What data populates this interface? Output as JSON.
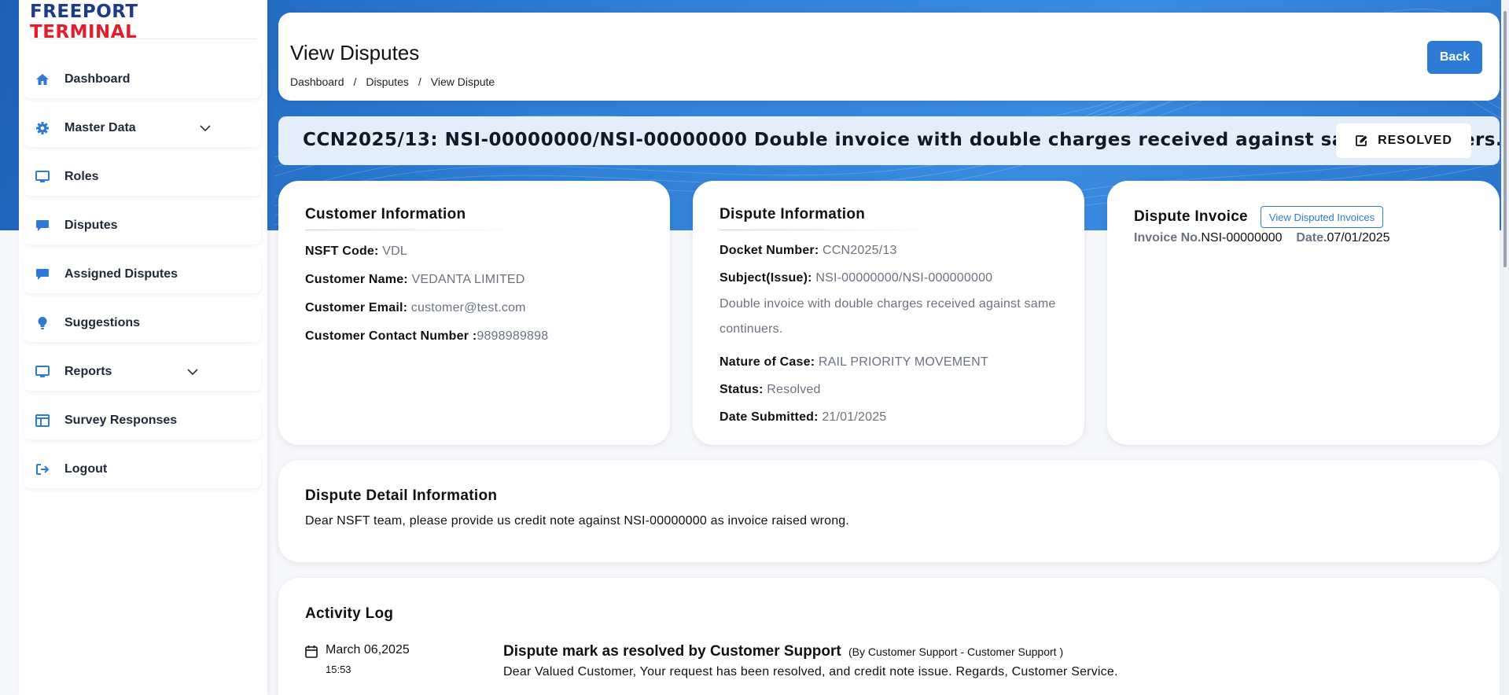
{
  "brand": {
    "part1": "FREEPORT",
    "part2": "TERMINAL"
  },
  "sidebar": {
    "items": [
      {
        "label": "Dashboard",
        "icon": "home-icon"
      },
      {
        "label": "Master Data",
        "icon": "gear-icon",
        "expandable": true
      },
      {
        "label": "Roles",
        "icon": "monitor-icon"
      },
      {
        "label": "Disputes",
        "icon": "chat-icon"
      },
      {
        "label": "Assigned Disputes",
        "icon": "chat-icon"
      },
      {
        "label": "Suggestions",
        "icon": "lightbulb-icon"
      },
      {
        "label": "Reports",
        "icon": "monitor-icon",
        "expandable": true
      },
      {
        "label": "Survey Responses",
        "icon": "table-icon"
      },
      {
        "label": "Logout",
        "icon": "logout-icon"
      }
    ]
  },
  "header": {
    "title": "View Disputes",
    "breadcrumb": [
      "Dashboard",
      "Disputes",
      "View Dispute"
    ],
    "separator": "/",
    "back_label": "Back"
  },
  "banner": {
    "title": "CCN2025/13: NSI-00000000/NSI-00000000 Double invoice with double charges received against same continuers.",
    "status_label": "RESOLVED"
  },
  "customer": {
    "heading": "Customer Information",
    "nsft_code_label": "NSFT Code:",
    "nsft_code": "VDL",
    "name_label": "Customer Name:",
    "name": "VEDANTA LIMITED",
    "email_label": "Customer Email:",
    "email": "customer@test.com",
    "contact_label": "Customer Contact Number :",
    "contact": "9898989898"
  },
  "dispute": {
    "heading": "Dispute Information",
    "docket_label": "Docket Number:",
    "docket": "CCN2025/13",
    "subject_label": "Subject(Issue):",
    "subject": "NSI-00000000/NSI-000000000",
    "description": "Double invoice with double charges received against same continuers.",
    "nature_label": "Nature of Case:",
    "nature": "RAIL PRIORITY MOVEMENT",
    "status_label": "Status:",
    "status": "Resolved",
    "date_label": "Date Submitted:",
    "date": "21/01/2025"
  },
  "invoice": {
    "heading": "Dispute Invoice",
    "view_button": "View Disputed Invoices",
    "invoice_no_label": "Invoice No.",
    "invoice_no": "NSI-00000000",
    "date_label": "Date.",
    "date": "07/01/2025"
  },
  "detail": {
    "heading": "Dispute Detail Information",
    "text": "Dear NSFT team, please provide us credit note against NSI-00000000 as invoice raised wrong."
  },
  "activity": {
    "heading": "Activity Log",
    "entries": [
      {
        "date": "March 06,2025",
        "time": "15:53",
        "title": "Dispute mark as resolved by Customer Support",
        "by": "(By Customer Support - Customer Support )",
        "message": "Dear Valued Customer, Your request has been resolved, and credit note issue. Regards, Customer Service."
      }
    ]
  },
  "colors": {
    "accent": "#2e7bd6",
    "brand_dark": "#1e3a8a",
    "brand_red": "#e11d2e",
    "banner_bg": "#e3eef9"
  }
}
